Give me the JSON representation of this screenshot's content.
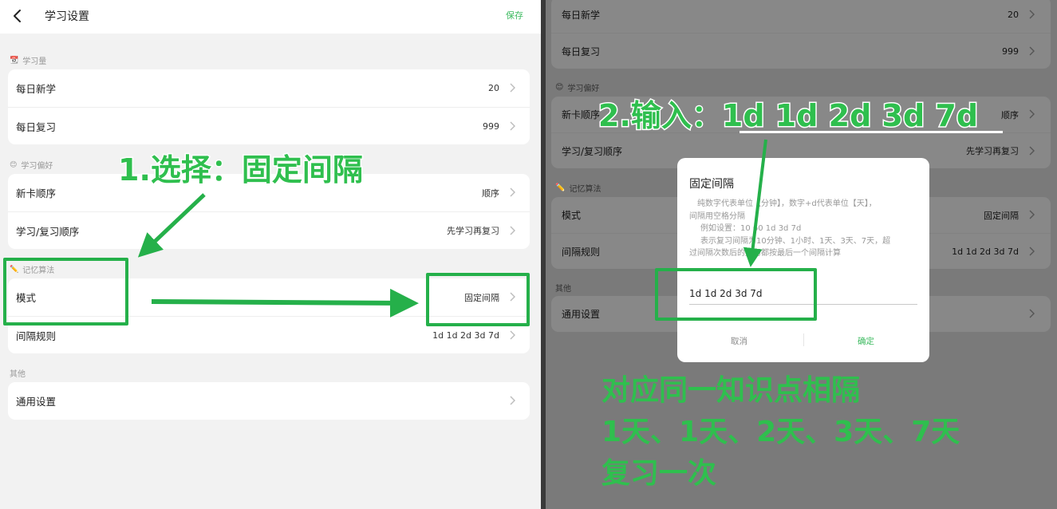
{
  "left": {
    "header": {
      "title": "学习设置",
      "save_label": "保存"
    },
    "sections": {
      "amount": {
        "icon": "📆",
        "label": "学习量"
      },
      "preference": {
        "icon": "😊",
        "label": "学习偏好"
      },
      "algorithm": {
        "icon": "✏️",
        "label": "记忆算法"
      },
      "other": {
        "label": "其他"
      }
    },
    "rows": {
      "daily_new": {
        "label": "每日新学",
        "value": "20"
      },
      "daily_review": {
        "label": "每日复习",
        "value": "999"
      },
      "new_card_order": {
        "label": "新卡顺序",
        "value": "顺序"
      },
      "study_review_order": {
        "label": "学习/复习顺序",
        "value": "先学习再复习"
      },
      "mode": {
        "label": "模式",
        "value": "固定间隔"
      },
      "interval_rule": {
        "label": "间隔规则",
        "value": "1d 1d 2d 3d 7d"
      },
      "general": {
        "label": "通用设置"
      }
    },
    "annotation": "1.选择：固定间隔"
  },
  "right": {
    "rows": {
      "daily_new": {
        "label": "每日新学",
        "value": "20"
      },
      "daily_review": {
        "label": "每日复习",
        "value": "999"
      },
      "new_card_order": {
        "label": "新卡顺序",
        "value": "顺序"
      },
      "study_review_order": {
        "label": "学习/复习顺序",
        "value": "先学习再复习"
      },
      "mode": {
        "label": "模式",
        "value": "固定间隔"
      },
      "interval_rule": {
        "label": "间隔规则",
        "value": "1d 1d 2d 3d 7d"
      },
      "general": {
        "label": "通用设置"
      }
    },
    "sections": {
      "preference": {
        "icon": "😊",
        "label": "学习偏好"
      },
      "algorithm": {
        "icon": "✏️",
        "label": "记忆算法"
      },
      "other": {
        "label": "其他"
      }
    },
    "dialog": {
      "title": "固定间隔",
      "desc_line1": "纯数字代表单位【分钟】，数字+d代表单位【天】，",
      "desc_line2": "间隔用空格分隔",
      "desc_line3": "例如设置：10 60 1d 3d 7d",
      "desc_line4": "表示复习间隔为10分钟、1小时、1天、3天、7天，超",
      "desc_line5": "过间隔次数后的复习都按最后一个间隔计算",
      "input_value": "1d 1d 2d 3d 7d",
      "cancel_label": "取消",
      "ok_label": "确定"
    },
    "annotation_input_prefix": "2.输入：",
    "annotation_input_value": "1d 1d 2d 3d 7d",
    "annotation_line1": "对应同一知识点相隔",
    "annotation_line2": "1天、1天、2天、3天、7天",
    "annotation_line3": "复习一次"
  },
  "colors": {
    "accent": "#3cba5f",
    "annotation": "#2fbf4e",
    "highlight_border": "#25b04a"
  },
  "icons": [
    "back-chevron-icon",
    "chevron-right-icon",
    "calendar-icon",
    "smile-icon",
    "pencil-icon"
  ]
}
